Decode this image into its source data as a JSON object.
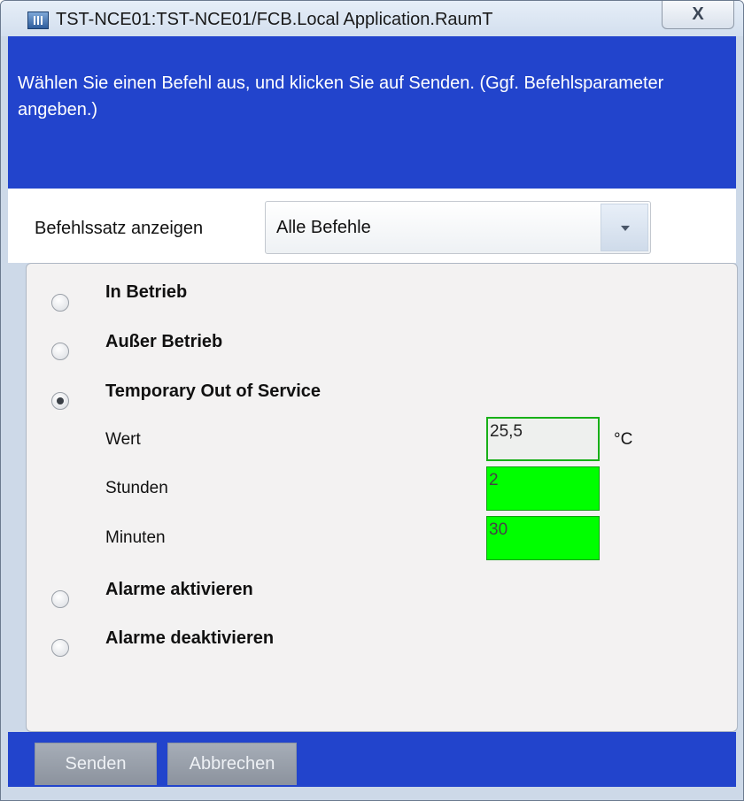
{
  "window": {
    "title": "TST-NCE01:TST-NCE01/FCB.Local Application.RaumT",
    "close_label": "X"
  },
  "header": {
    "instruction": "Wählen Sie einen Befehl aus, und klicken Sie auf Senden. (Ggf. Befehlsparameter angeben.)"
  },
  "command_set": {
    "label": "Befehlssatz anzeigen",
    "selected": "Alle Befehle"
  },
  "commands": [
    {
      "label": "In Betrieb",
      "checked": false
    },
    {
      "label": "Außer Betrieb",
      "checked": false
    },
    {
      "label": "Temporary Out of Service",
      "checked": true
    },
    {
      "label": "Alarme aktivieren",
      "checked": false
    },
    {
      "label": "Alarme deaktivieren",
      "checked": false
    }
  ],
  "parameters": {
    "wert": {
      "label": "Wert",
      "value": "25,5",
      "unit": "°C"
    },
    "stunden": {
      "label": "Stunden",
      "value": "2"
    },
    "minuten": {
      "label": "Minuten",
      "value": "30"
    }
  },
  "footer": {
    "send_label": "Senden",
    "cancel_label": "Abbrechen"
  },
  "colors": {
    "header_blue": "#2244cc",
    "field_green": "#00ff00",
    "field_border_green": "#18b018"
  }
}
